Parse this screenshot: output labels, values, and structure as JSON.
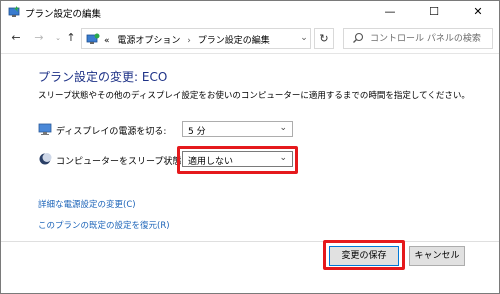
{
  "window": {
    "title": "プラン設定の編集",
    "minimize_glyph": "—",
    "maximize_glyph": "☐",
    "close_glyph": "✕"
  },
  "nav": {
    "back_glyph": "←",
    "forward_glyph": "→",
    "recent_glyph": "⌄",
    "up_glyph": "↑",
    "refresh_glyph": "↻",
    "address_overflow": "«",
    "breadcrumb": [
      "電源オプション",
      "プラン設定の編集"
    ],
    "breadcrumb_sep": "›",
    "address_dropdown_glyph": "⌄"
  },
  "search": {
    "placeholder": "コントロール パネルの検索"
  },
  "content": {
    "heading": "プラン設定の変更: ECO",
    "description": "スリープ状態やその他のディスプレイ設定をお使いのコンピューターに適用するまでの時間を指定してください。",
    "display_off": {
      "label": "ディスプレイの電源を切る:",
      "value": "5 分",
      "icon": "monitor-icon"
    },
    "sleep": {
      "label": "コンピューターをスリープ状態にする:",
      "value": "適用しない",
      "icon": "moon-icon",
      "highlighted": true
    },
    "link_advanced": "詳細な電源設定の変更(C)",
    "link_restore": "このプランの既定の設定を復元(R)"
  },
  "footer": {
    "save_label": "変更の保存",
    "cancel_label": "キャンセル",
    "save_highlighted": true
  },
  "colors": {
    "heading": "#1e3287",
    "link": "#1b63b8",
    "highlight": "#e5191c",
    "primary_border": "#0078d7"
  },
  "select_arrow_glyph": "⌄"
}
